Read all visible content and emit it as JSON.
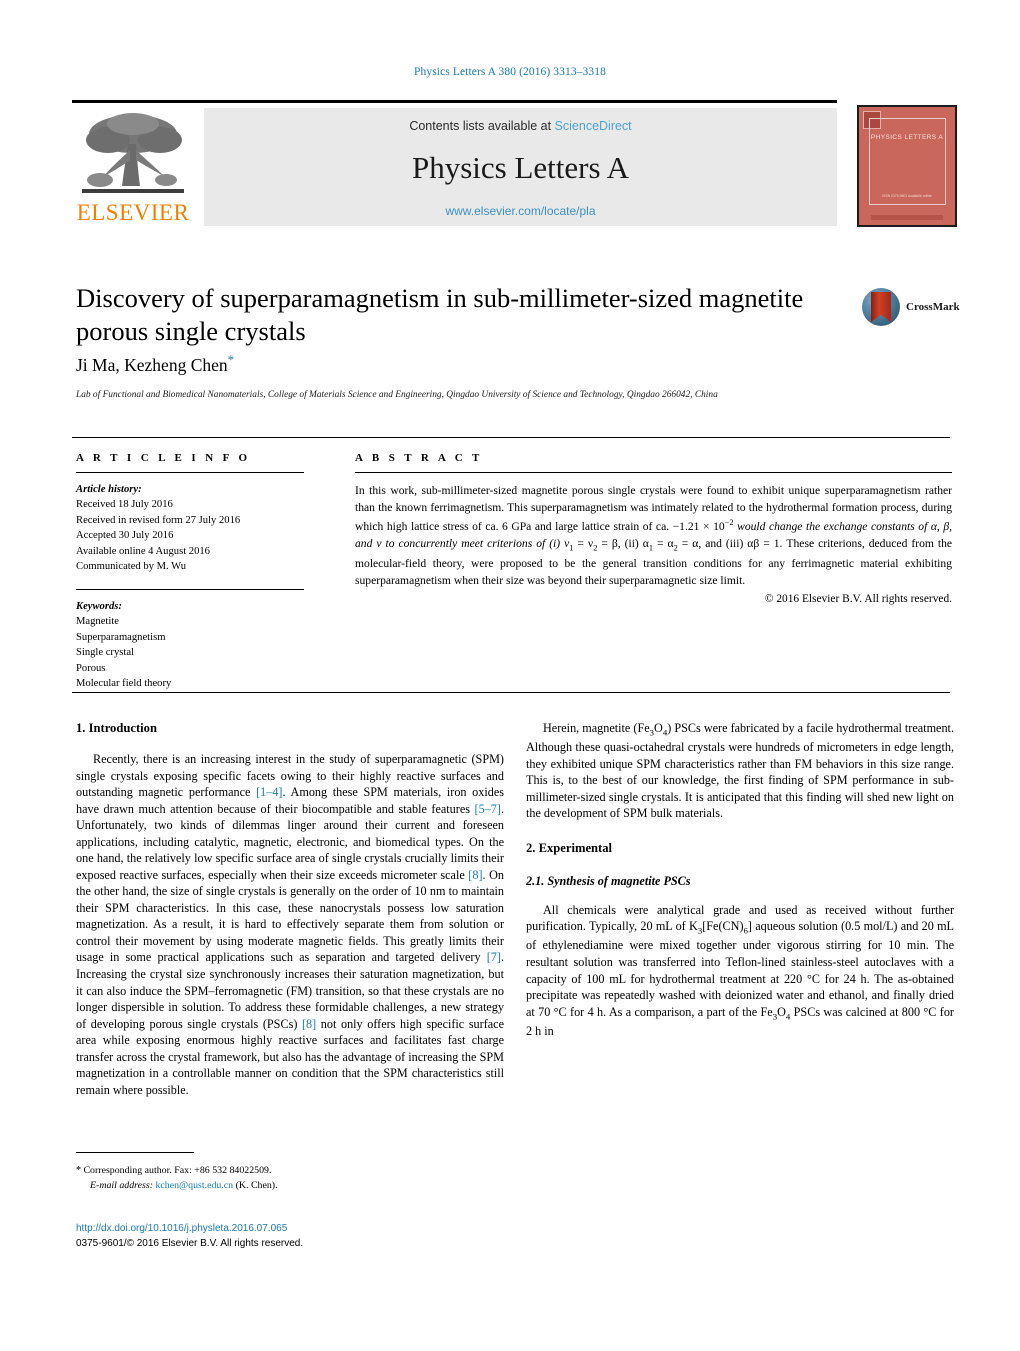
{
  "running_head": "Physics Letters A 380 (2016) 3313–3318",
  "masthead": {
    "contents_prefix": "Contents lists available at ",
    "sciencedirect": "ScienceDirect",
    "journal_title": "Physics Letters A",
    "journal_url": "www.elsevier.com/locate/pla",
    "publisher_wordmark": "ELSEVIER",
    "publisher_logo_icon": "elsevier-tree-icon",
    "cover": {
      "title": "PHYSICS LETTERS A",
      "footline": "ISSN 0375-9601\nAvailable online",
      "accent_color": "#c9675c"
    }
  },
  "article": {
    "title": "Discovery of superparamagnetism in sub-millimeter-sized magnetite porous single crystals",
    "authors": "Ji Ma, Kezheng Chen",
    "corresponding_marker": "*",
    "affiliation": "Lab of Functional and Biomedical Nanomaterials, College of Materials Science and Engineering, Qingdao University of Science and Technology, Qingdao 266042, China",
    "crossmark_label": "CrossMark",
    "crossmark_icon": "crossmark-icon"
  },
  "article_info": {
    "heading": "A R T I C L E   I N F O",
    "history_label": "Article history:",
    "history": [
      "Received 18 July 2016",
      "Received in revised form 27 July 2016",
      "Accepted 30 July 2016",
      "Available online 4 August 2016",
      "Communicated by M. Wu"
    ],
    "keywords_label": "Keywords:",
    "keywords": [
      "Magnetite",
      "Superparamagnetism",
      "Single crystal",
      "Porous",
      "Molecular field theory"
    ]
  },
  "abstract": {
    "heading": "A B S T R A C T",
    "part1": "In this work, sub-millimeter-sized magnetite porous single crystals were found to exhibit unique superparamagnetism rather than the known ferrimagnetism. This superparamagnetism was intimately related to the hydrothermal formation process, during which high lattice stress of ca. 6 GPa and large lattice strain of ca. −1.21 × 10",
    "exp1": "−2",
    "part2": " would change the exchange constants of α, β, and ν to concurrently meet criterions of (i) ν",
    "sub1": "1",
    "part3": " = ν",
    "sub2": "2",
    "part4": " = β, (ii) α",
    "sub3": "1",
    "part5": " = α",
    "sub4": "2",
    "part6": " = α, and (iii) αβ = 1. These criterions, deduced from the molecular-field theory, were proposed to be the general transition conditions for any ferrimagnetic material exhibiting superparamagnetism when their size was beyond their superparamagnetic size limit.",
    "copyright": "© 2016 Elsevier B.V. All rights reserved."
  },
  "body": {
    "section1_heading": "1. Introduction",
    "intro_p1_a": "Recently, there is an increasing interest in the study of superparamagnetic (SPM) single crystals exposing specific facets owing to their highly reactive surfaces and outstanding magnetic performance ",
    "intro_ref1": "[1–4]",
    "intro_p1_b": ". Among these SPM materials, iron oxides have drawn much attention because of their biocompatible and stable features ",
    "intro_ref2": "[5–7]",
    "intro_p1_c": ". Unfortunately, two kinds of dilemmas linger around their current and foreseen applications, including catalytic, magnetic, electronic, and biomedical types. On the one hand, the relatively low specific surface area of single crystals crucially limits their exposed reactive surfaces, especially when their size exceeds micrometer scale ",
    "intro_ref3": "[8]",
    "intro_p1_d": ". On the other hand, the size of single crystals is generally on the order of 10 nm to maintain their SPM characteristics. In this case, these nanocrystals possess low saturation magnetization. As a result, it is hard to effectively separate them from solution or control their movement by using moderate magnetic fields. This greatly limits their usage in some practical applications such as separation and targeted delivery ",
    "intro_ref4": "[7]",
    "intro_p1_e": ". Increasing the crystal size synchronously increases their saturation magnetization, but it can also induce the SPM–ferromagnetic (FM) transition, so that these crystals are no longer dispersible in solution. To address these formidable challenges, a new strategy of developing porous single crystals (PSCs) ",
    "intro_ref5": "[8]",
    "intro_p1_f": " not only offers high specific surface area while exposing enormous highly reactive surfaces and facilitates fast charge transfer across the crystal framework, but also has the advantage of increasing the SPM magnetization in a controllable manner on condition that the SPM characteristics still remain where possible.",
    "intro_p2_a": "Herein, magnetite (Fe",
    "intro_p2_sub1": "3",
    "intro_p2_b": "O",
    "intro_p2_sub2": "4",
    "intro_p2_c": ") PSCs were fabricated by a facile hydrothermal treatment. Although these quasi-octahedral crystals were hundreds of micrometers in edge length, they exhibited unique SPM characteristics rather than FM behaviors in this size range. This is, to the best of our knowledge, the first finding of SPM performance in sub-millimeter-sized single crystals. It is anticipated that this finding will shed new light on the development of SPM bulk materials.",
    "section2_heading": "2. Experimental",
    "section21_heading": "2.1. Synthesis of magnetite PSCs",
    "exp_p1_a": "All chemicals were analytical grade and used as received without further purification. Typically, 20 mL of K",
    "exp_sub1": "3",
    "exp_p1_b": "[Fe(CN)",
    "exp_sub2": "6",
    "exp_p1_c": "] aqueous solution (0.5 mol/L) and 20 mL of ethylenediamine were mixed together under vigorous stirring for 10 min. The resultant solution was transferred into Teflon-lined stainless-steel autoclaves with a capacity of 100 mL for hydrothermal treatment at 220 °C for 24 h. The as-obtained precipitate was repeatedly washed with deionized water and ethanol, and finally dried at 70 °C for 4 h. As a comparison, a part of the Fe",
    "exp_sub3": "3",
    "exp_p1_d": "O",
    "exp_sub4": "4",
    "exp_p1_e": " PSCs was calcined at 800 °C for 2 h in"
  },
  "footnote": {
    "star": "*",
    "corresponding": "Corresponding author. Fax: +86 532 84022509.",
    "email_label": "E-mail address:",
    "email": "kchen@qust.edu.cn",
    "email_suffix": "(K. Chen)."
  },
  "footer": {
    "doi": "http://dx.doi.org/10.1016/j.physleta.2016.07.065",
    "issn_line": "0375-9601/© 2016 Elsevier B.V. All rights reserved."
  },
  "colors": {
    "link": "#1a7aad",
    "sciencedirect": "#4fa3d1",
    "elsevier_orange": "#f08000",
    "band_grey": "#e9e9e9"
  }
}
